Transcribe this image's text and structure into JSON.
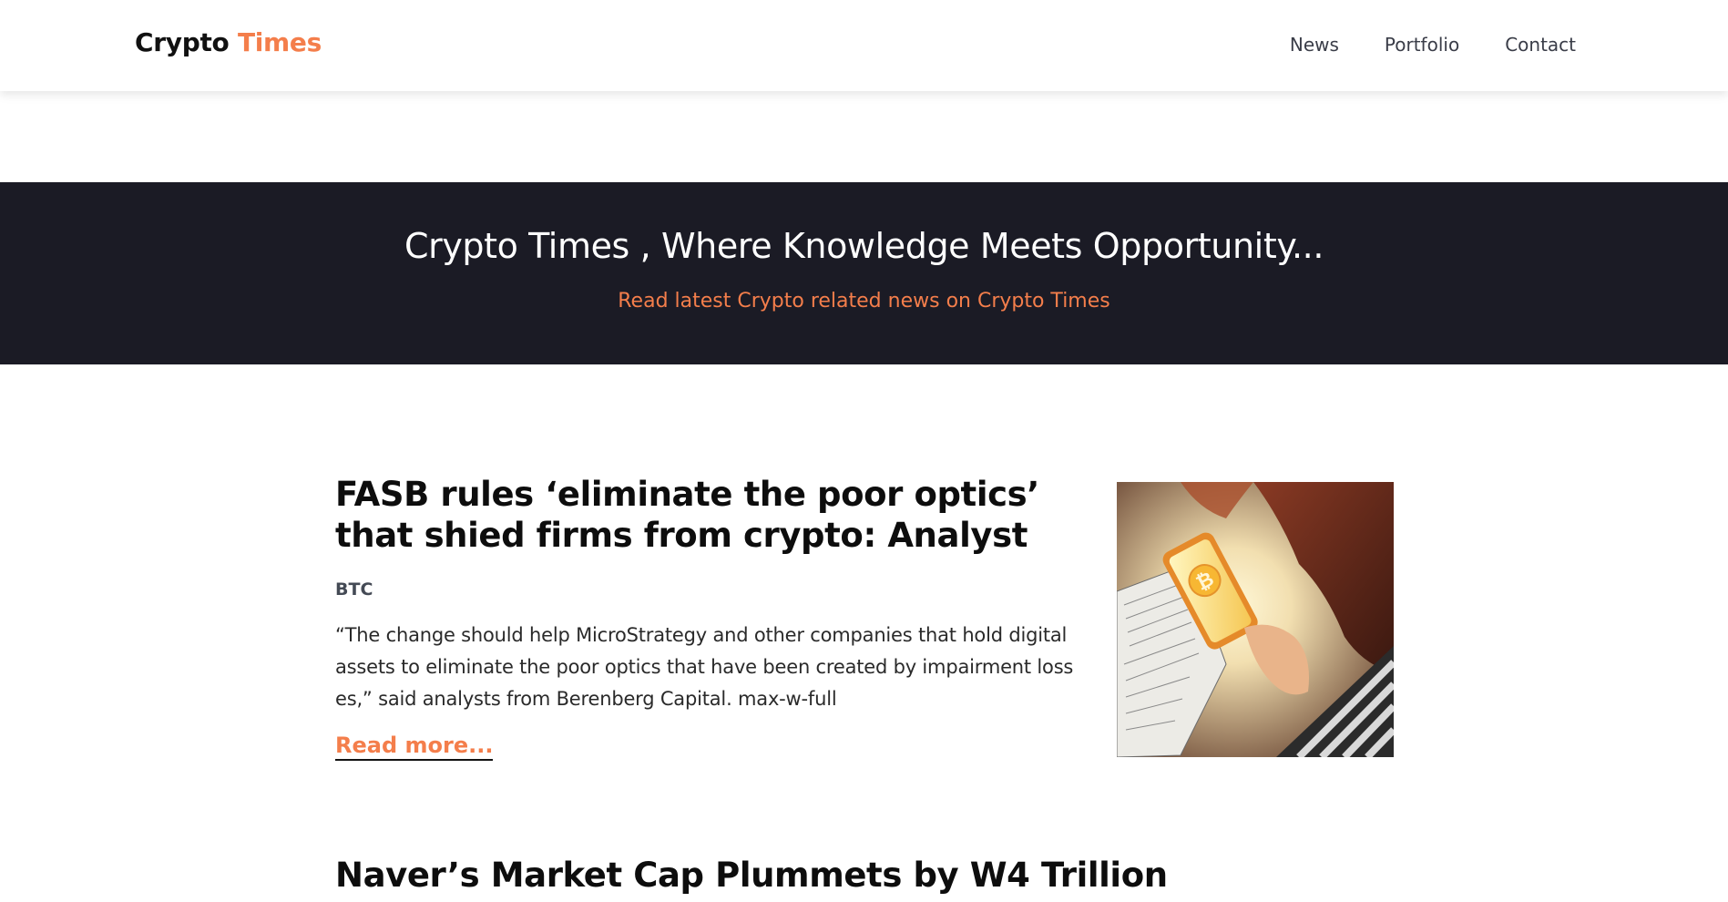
{
  "header": {
    "logo_part1": "Crypto",
    "logo_part2": "Times",
    "nav": [
      {
        "label": "News"
      },
      {
        "label": "Portfolio"
      },
      {
        "label": "Contact"
      }
    ]
  },
  "hero": {
    "title": "Crypto Times , Where Knowledge Meets Opportunity...",
    "subtitle": "Read latest Crypto related news on Crypto Times"
  },
  "articles": [
    {
      "title": "FASB rules ‘eliminate the poor optics’ that shied firms from crypto: Analyst",
      "category": "BTC",
      "excerpt": "“The change should help MicroStrategy and other companies that hold digital assets to eliminate the poor optics that have been created by impairment loss es,” said analysts from Berenberg Capital. max-w-full",
      "read_more": "Read more...",
      "image_icon": "bitcoin-phone-illustration"
    },
    {
      "title": "Naver’s Market Cap Plummets by W4 Trillion"
    }
  ],
  "colors": {
    "accent": "#f47e4b",
    "hero_bg": "#1b1b25",
    "nav_text": "#3a3d48"
  }
}
